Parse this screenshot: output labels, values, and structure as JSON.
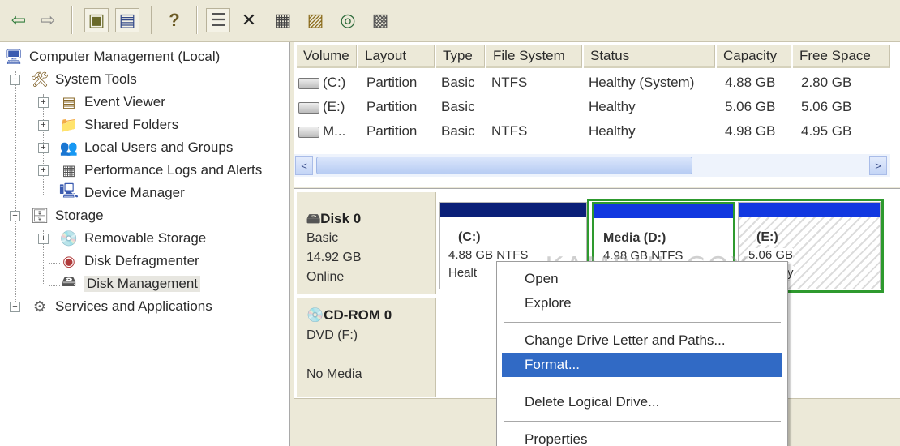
{
  "toolbar": {
    "buttons": [
      {
        "name": "back",
        "glyph": "⇦"
      },
      {
        "name": "forward",
        "glyph": "⇨"
      },
      {
        "name": "up",
        "glyph": "▣"
      },
      {
        "name": "show-hide-tree",
        "glyph": "▤"
      },
      {
        "name": "help",
        "glyph": "?"
      },
      {
        "name": "properties",
        "glyph": "☰"
      },
      {
        "name": "delete",
        "glyph": "✕"
      },
      {
        "name": "export",
        "glyph": "▦"
      },
      {
        "name": "open",
        "glyph": "▨"
      },
      {
        "name": "search",
        "glyph": "◎"
      },
      {
        "name": "settings",
        "glyph": "▩"
      }
    ]
  },
  "tree": {
    "root": "Computer Management (Local)",
    "system_tools": "System Tools",
    "event_viewer": "Event Viewer",
    "shared_folders": "Shared Folders",
    "local_users": "Local Users and Groups",
    "perf_logs": "Performance Logs and Alerts",
    "device_manager": "Device Manager",
    "storage": "Storage",
    "removable_storage": "Removable Storage",
    "disk_defrag": "Disk Defragmenter",
    "disk_management": "Disk Management",
    "services": "Services and Applications",
    "expand": "+",
    "collapse": "−"
  },
  "volume_list": {
    "columns": [
      "Volume",
      "Layout",
      "Type",
      "File System",
      "Status",
      "Capacity",
      "Free Space"
    ],
    "rows": [
      [
        "(C:)",
        "Partition",
        "Basic",
        "NTFS",
        "Healthy (System)",
        "4.88 GB",
        "2.80 GB"
      ],
      [
        "(E:)",
        "Partition",
        "Basic",
        "",
        "Healthy",
        "5.06 GB",
        "5.06 GB"
      ],
      [
        "M...",
        "Partition",
        "Basic",
        "NTFS",
        "Healthy",
        "4.98 GB",
        "4.95 GB"
      ]
    ],
    "scroll_left": "<",
    "scroll_right": ">"
  },
  "disks": {
    "disk0": {
      "title": "Disk 0",
      "type": "Basic",
      "size": "14.92 GB",
      "status": "Online",
      "partitions": [
        {
          "name": "(C:)",
          "detail": "4.88 GB NTFS",
          "status": "Healt"
        },
        {
          "name": "Media  (D:)",
          "detail": "4.98 GB NTFS",
          "status": ""
        },
        {
          "name": "(E:)",
          "detail": "5.06 GB",
          "status": "y"
        }
      ]
    },
    "cdrom0": {
      "title": "CD-ROM 0",
      "type": "DVD (F:)",
      "media": "No Media"
    }
  },
  "watermark": "KAMRUL.COX",
  "context_menu": {
    "items": [
      {
        "label": "Open"
      },
      {
        "label": "Explore"
      },
      {
        "label": "Change Drive Letter and Paths..."
      },
      {
        "label": "Format..."
      },
      {
        "label": "Delete Logical Drive..."
      },
      {
        "label": "Properties"
      }
    ],
    "highlighted": "Format..."
  },
  "colors": {
    "primary_bar": "#0a1f78",
    "logical_bar": "#1138e0",
    "selected_green": "#2e9a2e",
    "menu_highlight": "#316ac5",
    "window_bg": "#ece9d8"
  }
}
